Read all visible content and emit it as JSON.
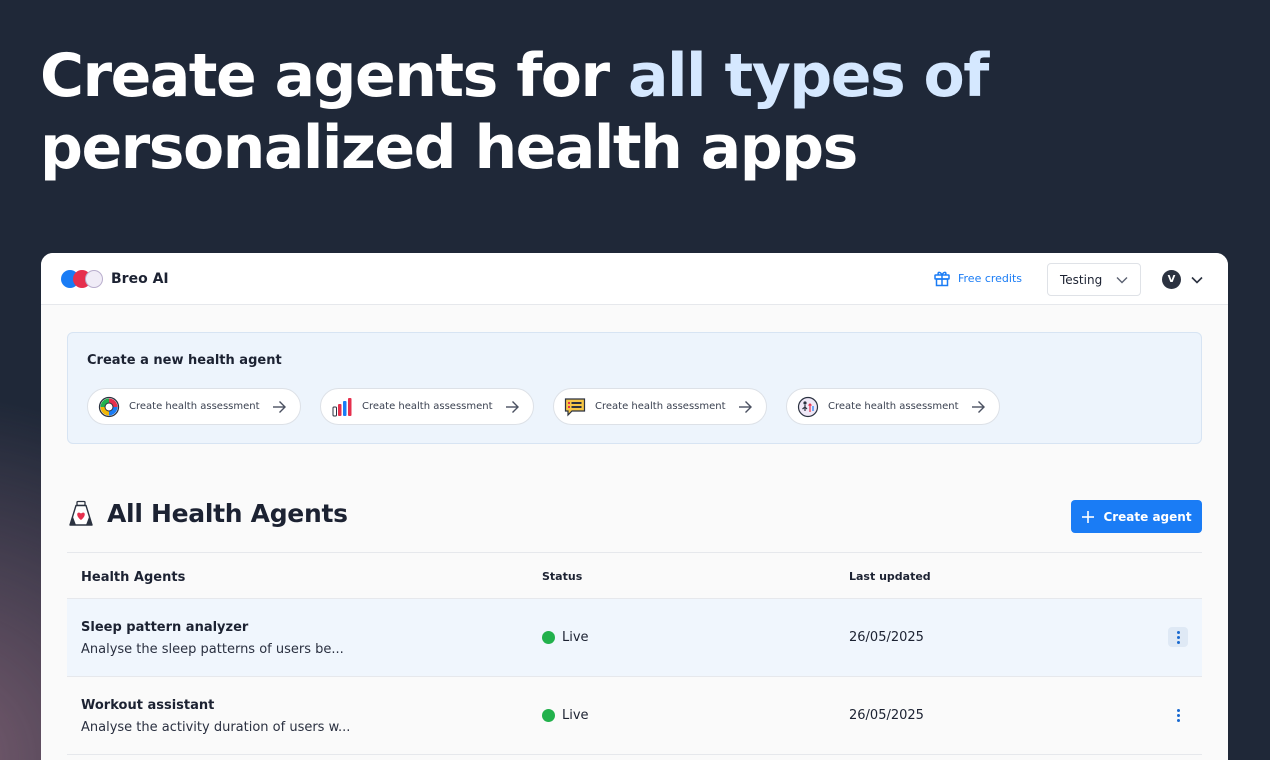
{
  "hero": {
    "line1_white": "Create agents for ",
    "line1_accent": "all types of",
    "line2": "personalized health apps"
  },
  "topbar": {
    "brand": "Breo AI",
    "free_credits": "Free credits",
    "environment": "Testing",
    "avatar_initial": "V"
  },
  "create_panel": {
    "title": "Create a new health agent",
    "pills": [
      {
        "label": "Create health assessment",
        "icon": "pie-chart-icon"
      },
      {
        "label": "Create health assessment",
        "icon": "bar-chart-icon"
      },
      {
        "label": "Create health assessment",
        "icon": "chat-list-icon"
      },
      {
        "label": "Create health assessment",
        "icon": "activity-icon"
      }
    ]
  },
  "agents_section": {
    "title": "All Health Agents",
    "create_button": "Create agent",
    "columns": [
      "Health Agents",
      "Status",
      "Last updated"
    ],
    "rows": [
      {
        "name": "Sleep pattern analyzer",
        "description": "Analyse the sleep patterns of users be...",
        "status": "Live",
        "updated": "26/05/2025"
      },
      {
        "name": "Workout assistant",
        "description": "Analyse the activity duration of users w...",
        "status": "Live",
        "updated": "26/05/2025"
      }
    ]
  },
  "colors": {
    "accent": "#1a7cf5",
    "live": "#22b14c",
    "background": "#1f2838"
  }
}
